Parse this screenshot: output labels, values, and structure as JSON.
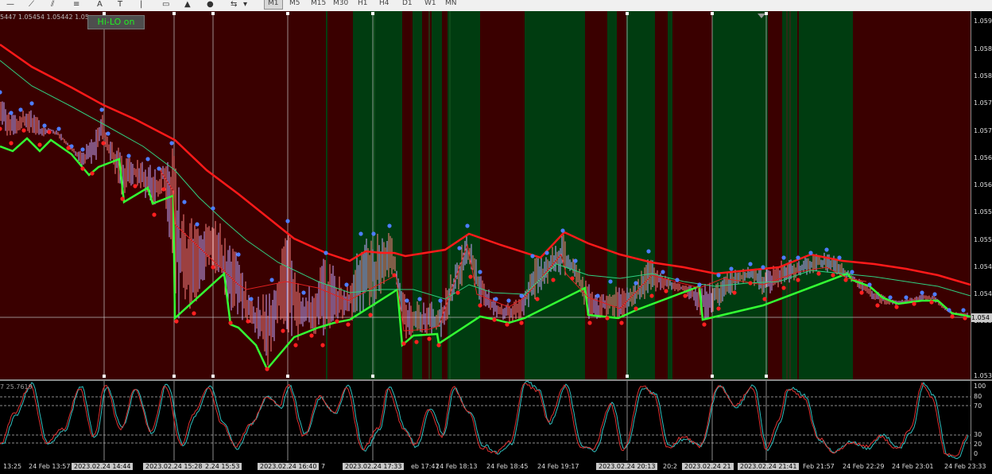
{
  "toolbar": {
    "tools": [
      "hline-icon",
      "trendline-icon",
      "channel-icon",
      "fibo-icon",
      "text-icon",
      "label-icon",
      "arrow-up-icon",
      "arrow-down-icon",
      "arrows-icon"
    ],
    "timeframes": [
      "M1",
      "M5",
      "M15",
      "M30",
      "H1",
      "H4",
      "D1",
      "W1",
      "MN"
    ],
    "active_timeframe": "M1"
  },
  "chart": {
    "ohlc_text": "5447 1.05454 1.05442 1.05",
    "hilo_label": "Hi-LO on",
    "current_price": "1.054",
    "price_scale": [
      "1.059",
      "1.058",
      "1.058",
      "1.057",
      "1.057",
      "1.056",
      "1.056",
      "1.055",
      "1.055",
      "1.054",
      "1.054",
      "1.053",
      "1.053"
    ],
    "osc_value_text": "7 25.7619",
    "osc_levels": [
      "100",
      "80",
      "70",
      "30",
      "20",
      "0"
    ],
    "time_labels": [
      {
        "text": "13:25",
        "hl": false
      },
      {
        "text": "24 Feb 13:57",
        "hl": false
      },
      {
        "text": "2023.02.24 14:44",
        "hl": true
      },
      {
        "text": "2023.02.24 15:28",
        "hl": true
      },
      {
        "text": "2.24 15:53",
        "hl": true
      },
      {
        "text": "2023.02.24 16:40",
        "hl": true
      },
      {
        "text": "7",
        "hl": false
      },
      {
        "text": "2023.02.24 17:33",
        "hl": true
      },
      {
        "text": "eb 17:41",
        "hl": false
      },
      {
        "text": "24 Feb 18:13",
        "hl": false
      },
      {
        "text": "24 Feb 18:45",
        "hl": false
      },
      {
        "text": "24 Feb 19:17",
        "hl": false
      },
      {
        "text": "2023.02.24 20:13",
        "hl": true
      },
      {
        "text": "20:2",
        "hl": false
      },
      {
        "text": "2023.02.24 21",
        "hl": true
      },
      {
        "text": "2023.02.24 21:41",
        "hl": true
      },
      {
        "text": "Feb 21:57",
        "hl": false
      },
      {
        "text": "24 Feb 22:29",
        "hl": false
      },
      {
        "text": "24 Feb 23:01",
        "hl": false
      },
      {
        "text": "24 Feb 23:33",
        "hl": false
      }
    ],
    "colors": {
      "bear_zone": "#3a0000",
      "bull_zone": "#003c10",
      "ma_slow": "#ff1a1a",
      "ma_fast": "#30d080",
      "lower_band": "#33ff33",
      "high_pivot": "#4d7dff",
      "low_pivot": "#ff2020",
      "candle_up": "#c8a8ff",
      "candle_down": "#ff8080",
      "osc_main": "#e03030",
      "osc_signal": "#30c0c0"
    }
  }
}
